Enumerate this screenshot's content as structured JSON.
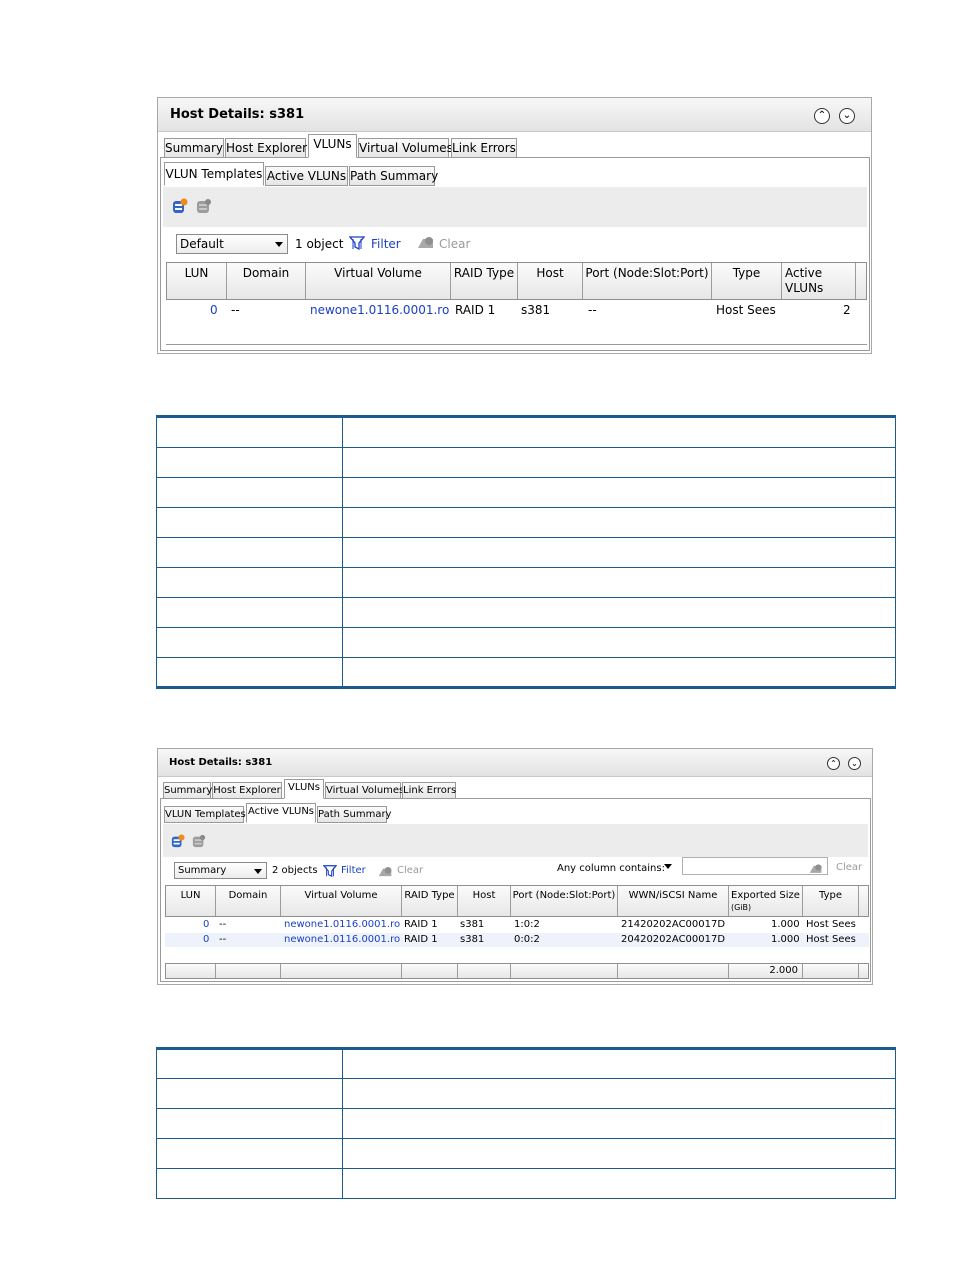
{
  "panel1": {
    "title": "Host Details: s381",
    "tabs": [
      "Summary",
      "Host Explorer",
      "VLUNs",
      "Virtual Volumes",
      "Link Errors"
    ],
    "subtabs": [
      "VLUN Templates",
      "Active VLUNs",
      "Path Summary"
    ],
    "filter_select": "Default",
    "object_count": "1 object",
    "filter_label": "Filter",
    "clear_label": "Clear",
    "columns": [
      "LUN",
      "Domain",
      "Virtual Volume",
      "RAID Type",
      "Host",
      "Port (Node:Slot:Port)",
      "Type",
      "Active",
      "VLUNs"
    ],
    "row": {
      "lun": "0",
      "domain": "--",
      "virtual_volume": "newone1.0116.0001.ro",
      "raid_type": "RAID 1",
      "host": "s381",
      "port": "--",
      "type": "Host Sees",
      "active_vluns": "2"
    }
  },
  "panel2": {
    "title": "Host Details: s381",
    "tabs": [
      "Summary",
      "Host Explorer",
      "VLUNs",
      "Virtual Volumes",
      "Link Errors"
    ],
    "subtabs": [
      "VLUN Templates",
      "Active VLUNs",
      "Path Summary"
    ],
    "filter_select": "Summary",
    "object_count": "2 objects",
    "filter_label": "Filter",
    "clear_label": "Clear",
    "any_column_label": "Any column contains:",
    "search_value": "",
    "search_clear_label": "Clear",
    "columns": [
      "LUN",
      "Domain",
      "Virtual Volume",
      "RAID Type",
      "Host",
      "Port (Node:Slot:Port)",
      "WWN/iSCSI Name",
      "Exported Size",
      "(GiB)",
      "Type"
    ],
    "rows": [
      {
        "lun": "0",
        "domain": "--",
        "virtual_volume": "newone1.0116.0001.ro",
        "raid_type": "RAID 1",
        "host": "s381",
        "port": "1:0:2",
        "wwn": "21420202AC00017D",
        "exported_size": "1.000",
        "type": "Host Sees"
      },
      {
        "lun": "0",
        "domain": "--",
        "virtual_volume": "newone1.0116.0001.ro",
        "raid_type": "RAID 1",
        "host": "s381",
        "port": "0:0:2",
        "wwn": "20420202AC00017D",
        "exported_size": "1.000",
        "type": "Host Sees"
      }
    ],
    "total_exported_size": "2.000"
  },
  "colors": {
    "link_blue": "#1a3fc4",
    "table_rule": "#1d5b8e"
  }
}
